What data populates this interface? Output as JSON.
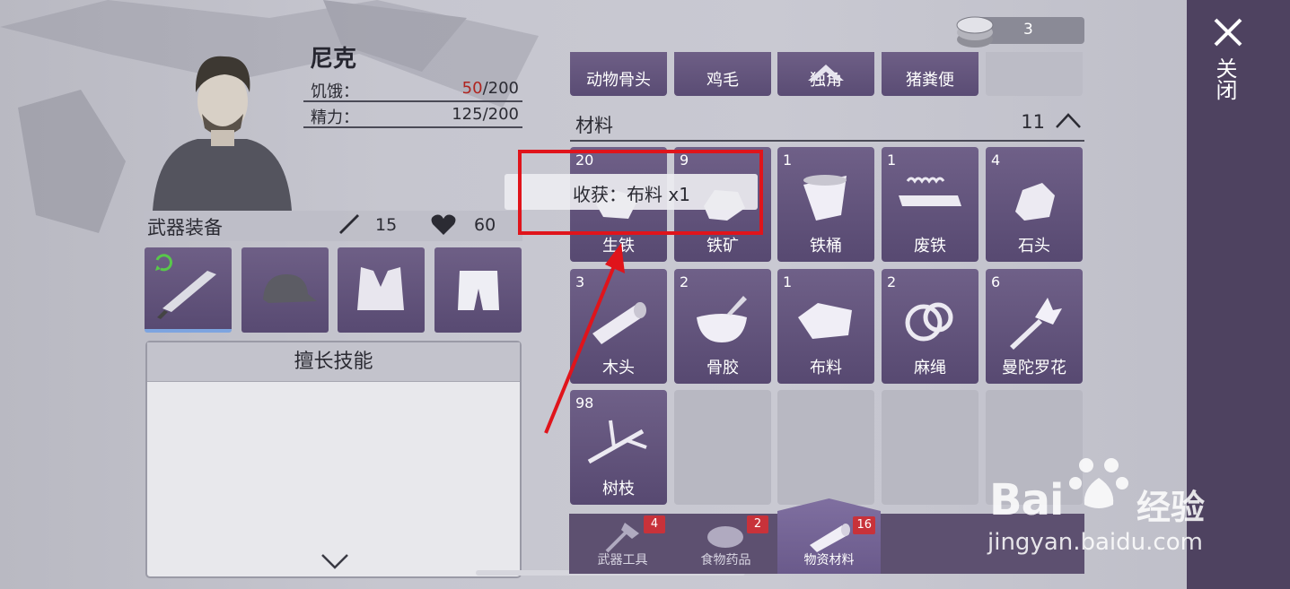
{
  "character": {
    "name": "尼克",
    "hunger_label": "饥饿：",
    "hunger_current": "50",
    "hunger_max": "/200",
    "energy_label": "精力：",
    "energy_value": "125/200"
  },
  "equipment": {
    "title": "武器装备",
    "attack": "15",
    "health": "60",
    "slots": [
      "weapon-knife",
      "cap",
      "vest",
      "shorts"
    ]
  },
  "skills": {
    "title": "擅长技能"
  },
  "currency": {
    "count": "3"
  },
  "partial_row": [
    "动物骨头",
    "鸡毛",
    "独角",
    "猪粪便"
  ],
  "section": {
    "title": "材料",
    "count": "11"
  },
  "items": [
    {
      "qty": "20",
      "name": "生铁",
      "icon": "iron-icon"
    },
    {
      "qty": "9",
      "name": "铁矿",
      "icon": "ore-icon"
    },
    {
      "qty": "1",
      "name": "铁桶",
      "icon": "bucket-icon"
    },
    {
      "qty": "1",
      "name": "废铁",
      "icon": "scrap-icon"
    },
    {
      "qty": "4",
      "name": "石头",
      "icon": "stone-icon"
    },
    {
      "qty": "3",
      "name": "木头",
      "icon": "wood-icon"
    },
    {
      "qty": "2",
      "name": "骨胶",
      "icon": "bone-glue-icon"
    },
    {
      "qty": "1",
      "name": "布料",
      "icon": "cloth-icon"
    },
    {
      "qty": "2",
      "name": "麻绳",
      "icon": "rope-icon"
    },
    {
      "qty": "6",
      "name": "曼陀罗花",
      "icon": "flower-icon"
    },
    {
      "qty": "98",
      "name": "树枝",
      "icon": "branch-icon"
    }
  ],
  "harvest": {
    "text": "收获：布料 x1"
  },
  "tabs": [
    {
      "label": "武器工具",
      "badge": "4"
    },
    {
      "label": "食物药品",
      "badge": "2"
    },
    {
      "label": "物资材料",
      "badge": "16"
    }
  ],
  "close": {
    "label": "关闭"
  },
  "watermark": {
    "brand": "Bai",
    "brand2": "经验",
    "url": "jingyan.baidu.com"
  },
  "colors": {
    "accent_purple": "#6f6088",
    "highlight_red": "#e0141b",
    "badge_red": "#c8323a"
  }
}
